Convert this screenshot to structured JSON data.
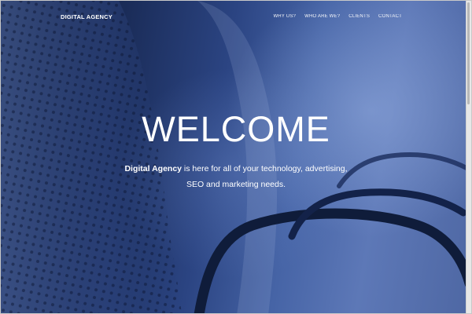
{
  "nav": {
    "brand": "DIGITAL AGENCY",
    "items": [
      "WHY US?",
      "WHO ARE WE?",
      "CLIENTS",
      "CONTACT"
    ]
  },
  "hero": {
    "title": "WELCOME",
    "brand_name": "Digital Agency",
    "text_rest": " is here for all of your technology, advertising, SEO and marketing needs."
  },
  "colors": {
    "accent_dark": "#0b1630",
    "accent_mid": "#2b4482",
    "accent_light": "#5d78b7",
    "text": "#ffffff"
  }
}
